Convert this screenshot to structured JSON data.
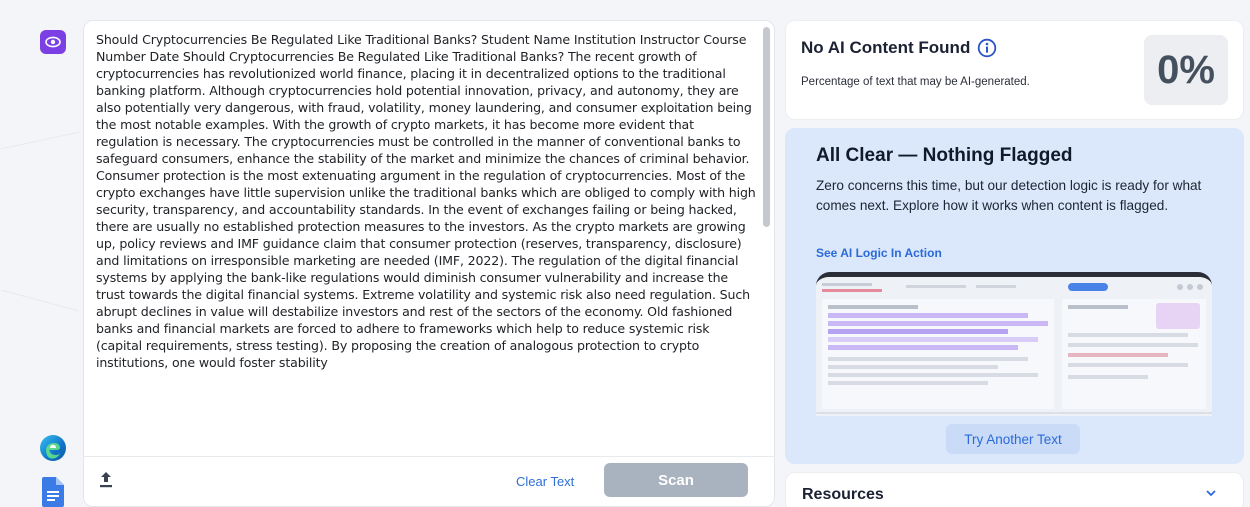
{
  "editor": {
    "essay_text": "Should Cryptocurrencies Be Regulated Like Traditional Banks? Student Name Institution Instructor Course Number Date Should Cryptocurrencies Be Regulated Like Traditional Banks? The recent growth of cryptocurrencies has revolutionized world finance, placing it in decentralized options to the traditional banking platform. Although cryptocurrencies hold potential innovation, privacy, and autonomy, they are also potentially very dangerous, with fraud, volatility, money laundering, and consumer exploitation being the most notable examples. With the growth of crypto markets, it has become more evident that regulation is necessary. The cryptocurrencies must be controlled in the manner of conventional banks to safeguard consumers, enhance the stability of the market and minimize the chances of criminal behavior. Consumer protection is the most extenuating argument in the regulation of cryptocurrencies. Most of the crypto exchanges have little supervision unlike the traditional banks which are obliged to comply with high security, transparency, and accountability standards. In the event of exchanges failing or being hacked, there are usually no established protection measures to the investors. As the crypto markets are growing up, policy reviews and IMF guidance claim that consumer protection (reserves, transparency, disclosure) and limitations on irresponsible marketing are needed (IMF, 2022). The regulation of the digital financial systems by applying the bank-like regulations would diminish consumer vulnerability and increase the trust towards the digital financial systems. Extreme volatility and systemic risk also need regulation. Such abrupt declines in value will destabilize investors and rest of the sectors of the economy. Old fashioned banks and financial markets are forced to adhere to frameworks which help to reduce systemic risk (capital requirements, stress testing). By proposing the creation of analogous protection to crypto institutions, one would foster stability",
    "clear_label": "Clear Text",
    "scan_label": "Scan"
  },
  "score": {
    "title": "No AI Content Found",
    "subtitle": "Percentage of text that may be AI-generated.",
    "percent": "0%"
  },
  "result": {
    "title": "All Clear — Nothing Flagged",
    "description": "Zero concerns this time, but our detection logic is ready for what comes next. Explore how it works when content is flagged.",
    "link_label": "See AI Logic In Action",
    "try_label": "Try Another Text"
  },
  "resources": {
    "title": "Resources"
  },
  "colors": {
    "accent_purple": "#7b3fe4",
    "link_blue": "#2b6ad8",
    "result_bg": "#dbe8fb",
    "scan_disabled": "#a9b2bf"
  },
  "icons": [
    "eye-icon",
    "edge-browser-icon",
    "google-docs-icon",
    "upload-icon",
    "info-icon",
    "chevron-down-icon"
  ]
}
